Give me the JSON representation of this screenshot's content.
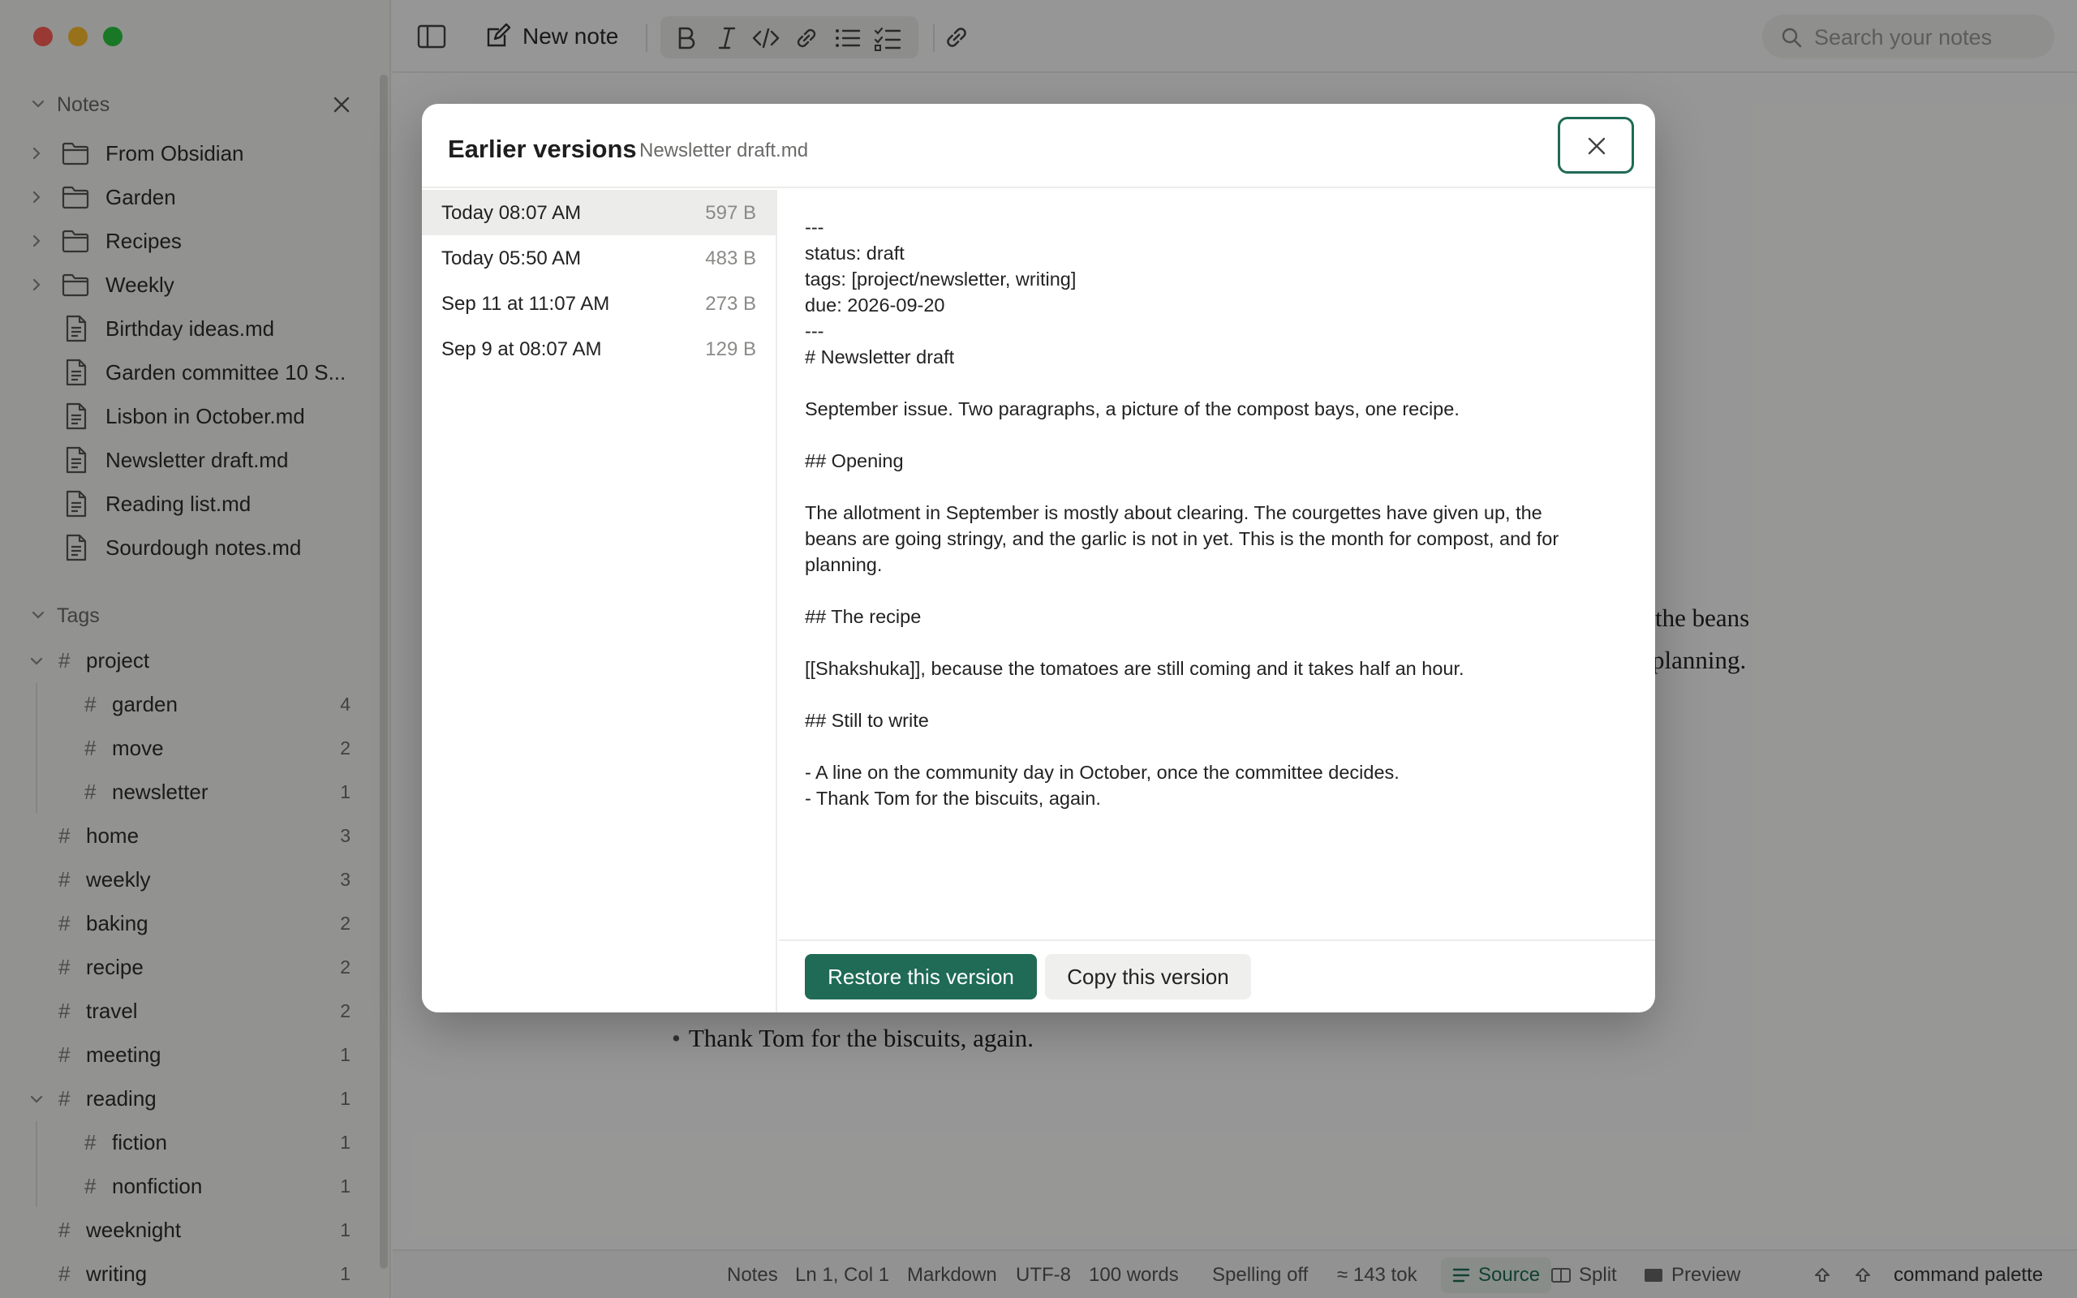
{
  "toolbar": {
    "new_note_label": "New note",
    "search_placeholder": "Search your notes"
  },
  "sidebar": {
    "notes_header": "Notes",
    "tree": [
      {
        "type": "folder",
        "label": "From Obsidian"
      },
      {
        "type": "folder",
        "label": "Garden"
      },
      {
        "type": "folder",
        "label": "Recipes"
      },
      {
        "type": "folder",
        "label": "Weekly"
      },
      {
        "type": "file",
        "label": "Birthday ideas.md"
      },
      {
        "type": "file",
        "label": "Garden committee 10 S..."
      },
      {
        "type": "file",
        "label": "Lisbon in October.md"
      },
      {
        "type": "file",
        "label": "Newsletter draft.md"
      },
      {
        "type": "file",
        "label": "Reading list.md"
      },
      {
        "type": "file",
        "label": "Sourdough notes.md"
      }
    ],
    "tags_header": "Tags",
    "tags": [
      {
        "name": "project",
        "count": "",
        "level": 0,
        "expandable": true
      },
      {
        "name": "garden",
        "count": "4",
        "level": 1
      },
      {
        "name": "move",
        "count": "2",
        "level": 1
      },
      {
        "name": "newsletter",
        "count": "1",
        "level": 1
      },
      {
        "name": "home",
        "count": "3",
        "level": 0
      },
      {
        "name": "weekly",
        "count": "3",
        "level": 0
      },
      {
        "name": "baking",
        "count": "2",
        "level": 0
      },
      {
        "name": "recipe",
        "count": "2",
        "level": 0
      },
      {
        "name": "travel",
        "count": "2",
        "level": 0
      },
      {
        "name": "meeting",
        "count": "1",
        "level": 0
      },
      {
        "name": "reading",
        "count": "1",
        "level": 0,
        "expandable": true
      },
      {
        "name": "fiction",
        "count": "1",
        "level": 1
      },
      {
        "name": "nonfiction",
        "count": "1",
        "level": 1
      },
      {
        "name": "weeknight",
        "count": "1",
        "level": 0
      },
      {
        "name": "writing",
        "count": "1",
        "level": 0
      }
    ]
  },
  "editor_background": {
    "line1": "the beans",
    "line2": "planning.",
    "bullet": "Thank Tom for the biscuits, again."
  },
  "statusbar": {
    "notes": "Notes",
    "position": "Ln 1, Col 1",
    "mode": "Markdown",
    "encoding": "UTF-8",
    "words": "100 words",
    "spelling": "Spelling off",
    "tokens": "≈ 143 tok",
    "source": "Source",
    "split": "Split",
    "preview": "Preview",
    "palette": "command palette"
  },
  "modal": {
    "title": "Earlier versions",
    "filename": "Newsletter draft.md",
    "versions": [
      {
        "date": "Today 08:07 AM",
        "size": "597 B",
        "selected": true
      },
      {
        "date": "Today 05:50 AM",
        "size": "483 B"
      },
      {
        "date": "Sep 11 at 11:07 AM",
        "size": "273 B"
      },
      {
        "date": "Sep 9 at 08:07 AM",
        "size": "129 B"
      }
    ],
    "content_lines": [
      "---",
      "status: draft",
      "tags: [project/newsletter, writing]",
      "due: 2026-09-20",
      "---",
      "# Newsletter draft",
      "",
      "September issue. Two paragraphs, a picture of the compost bays, one recipe.",
      "",
      "## Opening",
      "",
      "The allotment in September is mostly about clearing. The courgettes have given up, the",
      "beans are going stringy, and the garlic is not in yet. This is the month for compost, and for",
      "planning.",
      "",
      "## The recipe",
      "",
      "[[Shakshuka]], because the tomatoes are still coming and it takes half an hour.",
      "",
      "## Still to write",
      "",
      "- A line on the community day in October, once the committee decides.",
      "- Thank Tom for the biscuits, again."
    ],
    "restore_label": "Restore this version",
    "copy_label": "Copy this version"
  },
  "colors": {
    "accent": "#1f6b55"
  }
}
